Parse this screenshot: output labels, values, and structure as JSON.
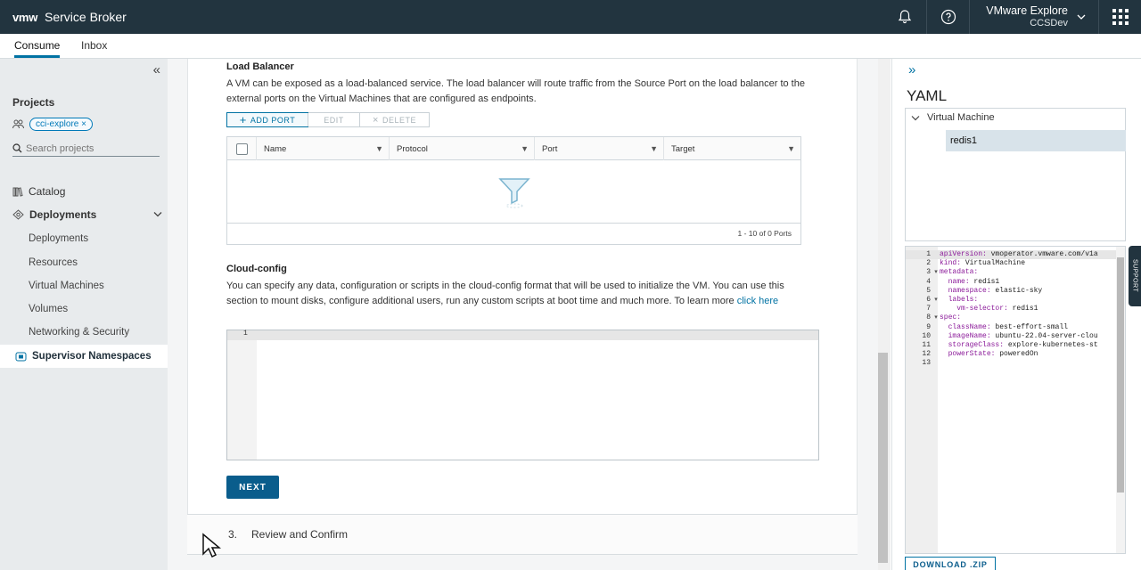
{
  "header": {
    "logo": "vmw",
    "app_title": "Service Broker",
    "org_name": "VMware Explore",
    "org_sub": "CCSDev",
    "icons": [
      "bell-icon",
      "help-icon",
      "chevron-down-icon",
      "app-grid-icon"
    ]
  },
  "subnav": {
    "tabs": [
      "Consume",
      "Inbox"
    ],
    "active": "Consume"
  },
  "sidebar": {
    "projects_label": "Projects",
    "project_chip": "cci-explore",
    "search_placeholder": "Search projects",
    "catalog": "Catalog",
    "deployments_header": "Deployments",
    "sub_items": [
      "Deployments",
      "Resources",
      "Virtual Machines",
      "Volumes",
      "Networking & Security"
    ],
    "active_item": "Supervisor Namespaces"
  },
  "load_balancer": {
    "title": "Load Balancer",
    "description": "A VM can be exposed as a load-balanced service. The load balancer will route traffic from the Source Port on the load balancer to the external ports on the Virtual Machines that are configured as endpoints.",
    "buttons": {
      "add": "ADD PORT",
      "edit": "EDIT",
      "delete": "DELETE"
    },
    "columns": [
      "Name",
      "Protocol",
      "Port",
      "Target"
    ],
    "footer": "1 - 10 of 0 Ports"
  },
  "cloud_config": {
    "title": "Cloud-config",
    "description": "You can specify any data, configuration or scripts in the cloud-config format that will be used to initialize the VM. You can use this section to mount disks, configure additional users, run any custom scripts at boot time and much more. To learn more",
    "link": "click here",
    "line_number": "1"
  },
  "next_label": "NEXT",
  "step3": {
    "number": "3.",
    "label": "Review and Confirm"
  },
  "yaml_panel": {
    "title": "YAML",
    "tree_root": "Virtual Machine",
    "tree_leaf": "redis1",
    "lines": [
      {
        "n": "1",
        "key": "apiVersion:",
        "val": " vmoperator.vmware.com/v1a",
        "indent": ""
      },
      {
        "n": "2",
        "key": "kind:",
        "val": " VirtualMachine",
        "indent": ""
      },
      {
        "n": "3",
        "key": "metadata:",
        "val": "",
        "indent": "",
        "fold": true
      },
      {
        "n": "4",
        "key": "name:",
        "val": " redis1",
        "indent": "  "
      },
      {
        "n": "5",
        "key": "namespace:",
        "val": " elastic-sky",
        "indent": "  "
      },
      {
        "n": "6",
        "key": "labels:",
        "val": "",
        "indent": "  ",
        "fold": true
      },
      {
        "n": "7",
        "key": "vm-selector:",
        "val": " redis1",
        "indent": "    "
      },
      {
        "n": "8",
        "key": "spec:",
        "val": "",
        "indent": "",
        "fold": true
      },
      {
        "n": "9",
        "key": "className:",
        "val": " best-effort-small",
        "indent": "  "
      },
      {
        "n": "10",
        "key": "imageName:",
        "val": " ubuntu-22.04-server-clou",
        "indent": "  "
      },
      {
        "n": "11",
        "key": "storageClass:",
        "val": " explore-kubernetes-st",
        "indent": "  "
      },
      {
        "n": "12",
        "key": "powerState:",
        "val": " poweredOn",
        "indent": "  "
      },
      {
        "n": "13",
        "key": "",
        "val": "",
        "indent": ""
      }
    ],
    "download_label": "DOWNLOAD .ZIP"
  },
  "support_tab": "SUPPORT",
  "colors": {
    "header_bg": "#22343f",
    "accent": "#0072a3",
    "primary_button": "#0a5d8c",
    "sidebar_bg": "#e8ebed"
  }
}
